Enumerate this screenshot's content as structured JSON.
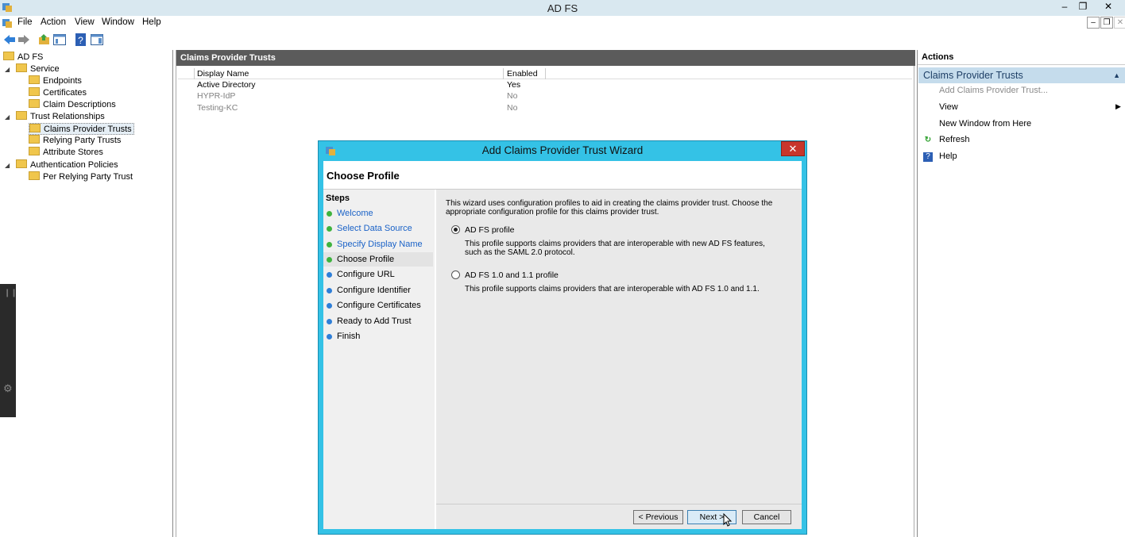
{
  "window": {
    "title": "AD FS",
    "minimize": "–",
    "restore": "❐",
    "close": "✕"
  },
  "mdi": {
    "minimize": "–",
    "restore": "❐",
    "close": "✕"
  },
  "menu": [
    "File",
    "Action",
    "View",
    "Window",
    "Help"
  ],
  "tree": {
    "root": "AD FS",
    "service": "Service",
    "endpoints": "Endpoints",
    "certificates": "Certificates",
    "claim_descriptions": "Claim Descriptions",
    "trust_relationships": "Trust Relationships",
    "claims_provider_trusts": "Claims Provider Trusts",
    "relying_party_trusts": "Relying Party Trusts",
    "attribute_stores": "Attribute Stores",
    "authentication_policies": "Authentication Policies",
    "per_relying_party_trust": "Per Relying Party Trust"
  },
  "center": {
    "title": "Claims Provider Trusts",
    "columns": {
      "display_name": "Display Name",
      "enabled": "Enabled"
    },
    "rows": [
      {
        "name": "Active Directory",
        "enabled": "Yes"
      },
      {
        "name": "HYPR-IdP",
        "enabled": "No"
      },
      {
        "name": "Testing-KC",
        "enabled": "No"
      }
    ]
  },
  "actions": {
    "header": "Actions",
    "section": "Claims Provider Trusts",
    "add": "Add Claims Provider Trust...",
    "view": "View",
    "new_window": "New Window from Here",
    "refresh": "Refresh",
    "help": "Help"
  },
  "dialog": {
    "title": "Add Claims Provider Trust Wizard",
    "page_title": "Choose Profile",
    "steps_header": "Steps",
    "steps": [
      "Welcome",
      "Select Data Source",
      "Specify Display Name",
      "Choose Profile",
      "Configure URL",
      "Configure Identifier",
      "Configure Certificates",
      "Ready to Add Trust",
      "Finish"
    ],
    "intro": "This wizard uses configuration profiles to aid in creating the claims provider trust.  Choose the appropriate configuration profile for this claims provider trust.",
    "option1_label": "AD FS profile",
    "option1_desc": "This profile supports claims providers that are interoperable with new AD FS features, such as the SAML 2.0 protocol.",
    "option2_label": "AD FS 1.0 and 1.1 profile",
    "option2_desc": "This profile supports claims providers that are interoperable with AD FS 1.0 and 1.1.",
    "selected_option": "AD FS profile",
    "btn_previous": "< Previous",
    "btn_next": "Next >",
    "btn_cancel": "Cancel"
  },
  "colors": {
    "accent": "#34c2e6",
    "header_dark": "#5b5b5b",
    "section_bg": "#c5dcec",
    "step_done": "#3fb33f",
    "step_todo": "#2f7fd8",
    "link": "#1a62c7"
  }
}
